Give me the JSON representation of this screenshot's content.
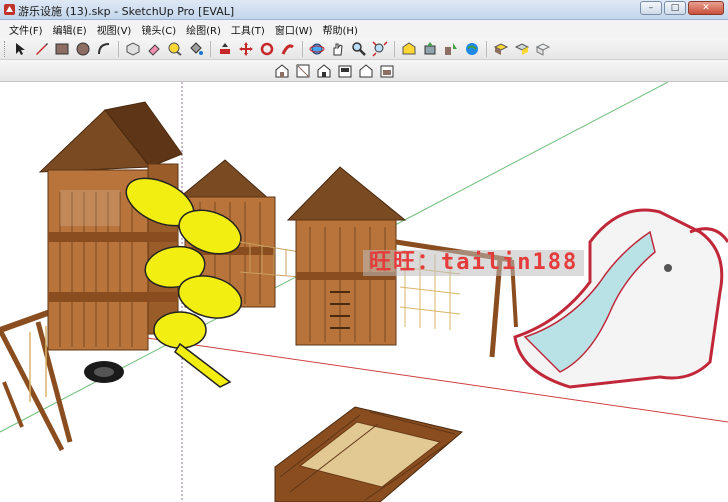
{
  "window": {
    "title": "游乐设施 (13).skp - SketchUp Pro [EVAL]",
    "minimize_glyph": "–",
    "maximize_glyph": "□",
    "close_glyph": "✕"
  },
  "menu": {
    "items": [
      {
        "label": "文件(F)"
      },
      {
        "label": "编辑(E)"
      },
      {
        "label": "视图(V)"
      },
      {
        "label": "镜头(C)"
      },
      {
        "label": "绘图(R)"
      },
      {
        "label": "工具(T)"
      },
      {
        "label": "窗口(W)"
      },
      {
        "label": "帮助(H)"
      }
    ]
  },
  "toolbar": {
    "tools": [
      "select-icon",
      "pencil-line-icon",
      "rectangle-icon",
      "circle-icon",
      "arc-icon",
      "make-component-icon",
      "eraser-icon",
      "tape-measure-icon",
      "paint-bucket-icon",
      "push-pull-icon",
      "move-icon",
      "rotate-icon",
      "follow-me-icon",
      "orbit-icon",
      "pan-icon",
      "zoom-icon",
      "zoom-extents-icon",
      "3d-warehouse-icon",
      "share-model-icon",
      "get-models-icon",
      "google-earth-icon",
      "component-icon",
      "extension-icon",
      "style-icon"
    ],
    "views": [
      "iso-view-icon",
      "top-view-icon",
      "front-view-icon",
      "right-view-icon",
      "back-view-icon",
      "left-view-icon"
    ]
  },
  "viewport": {
    "watermark": "旺旺：tailin188"
  },
  "colors": {
    "wood": "#b8743a",
    "wood_dark": "#8a4d1f",
    "roof": "#7a4a22",
    "slide_yellow": "#f2ee12",
    "elephant_slide": "#b8e2e6",
    "elephant_trim": "#c0283a",
    "axis_green": "#6fbf7a",
    "axis_red": "#d04040",
    "sand": "#e2c892"
  }
}
